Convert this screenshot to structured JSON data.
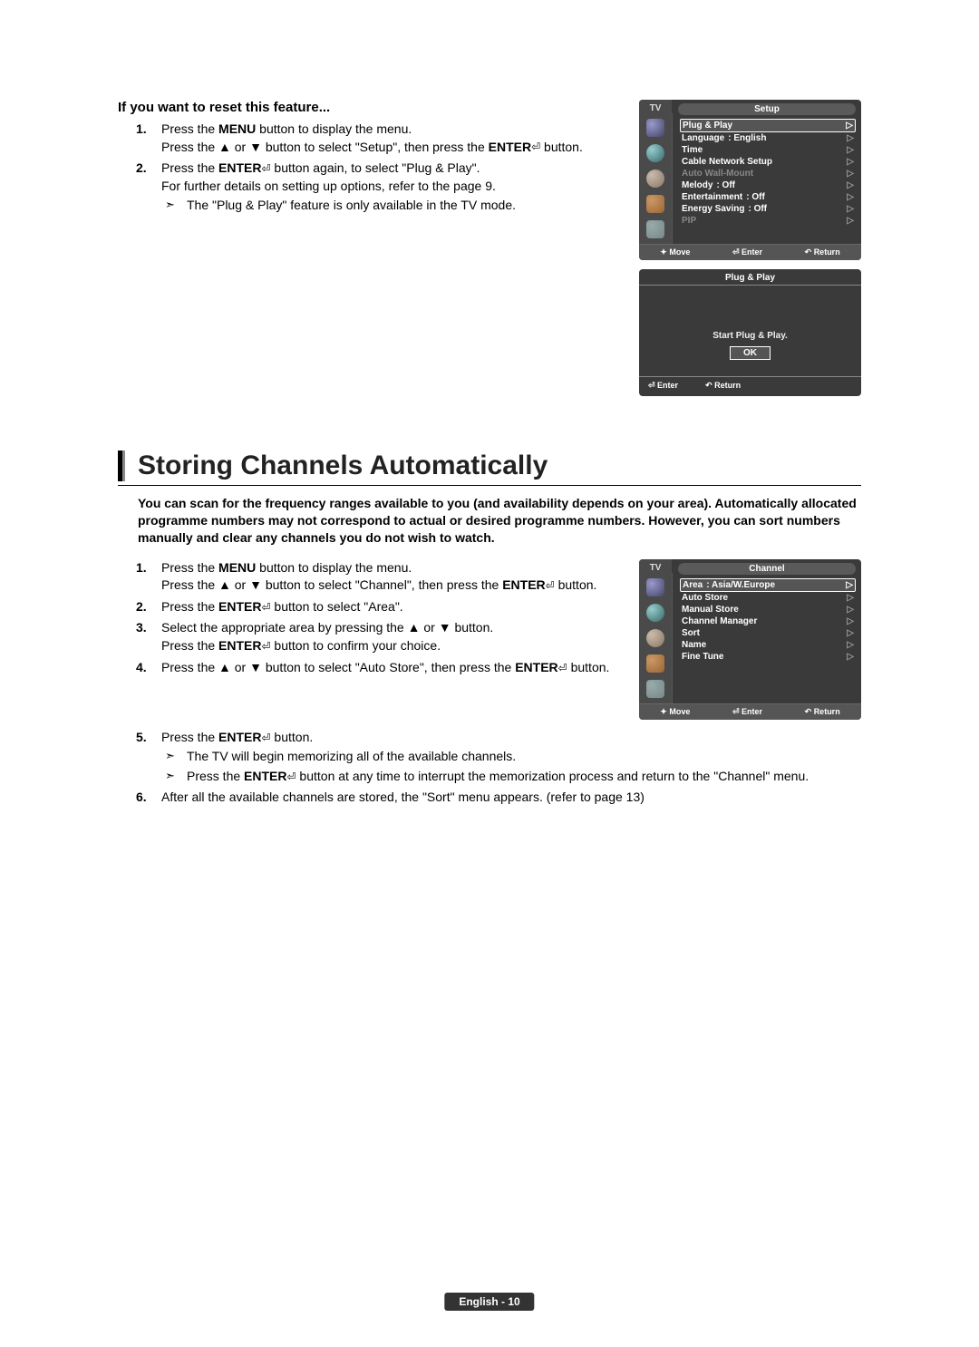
{
  "reset": {
    "heading": "If you want to reset this feature...",
    "step1a": "Press the ",
    "step1_menu": "MENU",
    "step1b": " button to display the menu.",
    "step1c": "Press the ▲ or ▼ button to select \"Setup\", then press the ",
    "step1_enter": "ENTER",
    "step1d": " button.",
    "step2a": "Press the ",
    "step2_enter": "ENTER",
    "step2b": " button again, to select \"Plug & Play\".",
    "step2c": "For further details on setting up options, refer to the page 9.",
    "note1": "The \"Plug & Play\" feature is only available in the TV mode."
  },
  "osd_setup": {
    "tv": "TV",
    "title": "Setup",
    "items": [
      {
        "label": "Plug & Play",
        "value": "",
        "sel": true
      },
      {
        "label": "Language",
        "value": ": English"
      },
      {
        "label": "Time",
        "value": ""
      },
      {
        "label": "Cable Network Setup",
        "value": ""
      },
      {
        "label": "Auto Wall-Mount",
        "value": "",
        "dim": true
      },
      {
        "label": "Melody",
        "value": ": Off"
      },
      {
        "label": "Entertainment",
        "value": ": Off"
      },
      {
        "label": "Energy Saving",
        "value": ": Off"
      },
      {
        "label": "PIP",
        "value": "",
        "dim": true
      }
    ],
    "move": "Move",
    "enter": "Enter",
    "return": "Return"
  },
  "osd_plugplay": {
    "title": "Plug & Play",
    "msg": "Start Plug & Play.",
    "ok": "OK",
    "enter": "Enter",
    "return": "Return"
  },
  "section2": {
    "title": "Storing Channels Automatically",
    "intro": "You can scan for the frequency ranges available to you (and availability depends on your area). Automatically allocated programme numbers may not correspond to actual or desired programme numbers. However, you can sort numbers manually and clear any channels you do not wish to watch.",
    "s1a": "Press the ",
    "s1_menu": "MENU",
    "s1b": " button to display the menu.",
    "s1c": "Press the ▲ or ▼ button to select \"Channel\", then press the ",
    "s1_enter": "ENTER",
    "s1d": " button.",
    "s2a": "Press the ",
    "s2_enter": "ENTER",
    "s2b": " button to select \"Area\".",
    "s3a": "Select the appropriate area by pressing the ▲ or ▼ button.",
    "s3b": "Press the ",
    "s3_enter": "ENTER",
    "s3c": " button to confirm your choice.",
    "s4a": "Press the ▲ or ▼ button to select \"Auto Store\", then press the ",
    "s4_enter": "ENTER",
    "s4b": " button.",
    "s5a": "Press the ",
    "s5_enter": "ENTER",
    "s5b": " button.",
    "s5_note1": "The TV will begin memorizing all of the available channels.",
    "s5_note2a": "Press the ",
    "s5_note2_enter": "ENTER",
    "s5_note2b": " button at any time to interrupt the memorization process and return to the \"Channel\" menu.",
    "s6": "After all the available channels are stored, the \"Sort\" menu appears. (refer to page 13)"
  },
  "osd_channel": {
    "tv": "TV",
    "title": "Channel",
    "items": [
      {
        "label": "Area",
        "value": ": Asia/W.Europe",
        "sel": true
      },
      {
        "label": "Auto Store",
        "value": ""
      },
      {
        "label": "Manual Store",
        "value": ""
      },
      {
        "label": "Channel Manager",
        "value": ""
      },
      {
        "label": "Sort",
        "value": ""
      },
      {
        "label": "Name",
        "value": ""
      },
      {
        "label": "Fine Tune",
        "value": ""
      }
    ],
    "move": "Move",
    "enter": "Enter",
    "return": "Return"
  },
  "footer": "English - 10"
}
